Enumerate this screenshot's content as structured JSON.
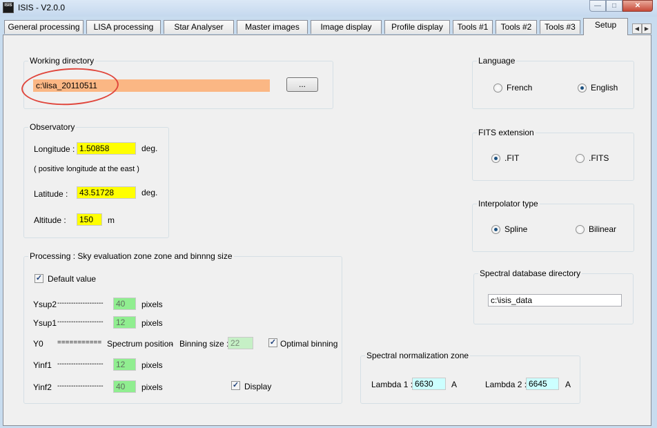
{
  "window": {
    "title": "ISIS - V2.0.0",
    "icon_text": "ISIS"
  },
  "tabs": [
    "General processing",
    "LISA processing",
    "Star Analyser",
    "Master images",
    "Image display",
    "Profile display",
    "Tools #1",
    "Tools #2",
    "Tools #3",
    "Setup"
  ],
  "active_tab": "Setup",
  "working_directory": {
    "title": "Working directory",
    "value": "c:\\lisa_20110511",
    "browse_label": "..."
  },
  "observatory": {
    "title": "Observatory",
    "longitude_label": "Longitude :",
    "longitude_value": "1.50858",
    "longitude_unit": "deg.",
    "longitude_note": "( positive longitude at the east )",
    "latitude_label": "Latitude :",
    "latitude_value": "43.51728",
    "latitude_unit": "deg.",
    "altitude_label": "Altitude :",
    "altitude_value": "150",
    "altitude_unit": "m"
  },
  "processing": {
    "title": "Processing : Sky evaluation zone zone and binnng size",
    "default_value_label": "Default value",
    "default_value_checked": true,
    "ysup2_label": "Ysup2",
    "ysup2_dashes": "--------------------",
    "ysup2_value": "40",
    "ysup1_label": "Ysup1",
    "ysup1_dashes": "--------------------",
    "ysup1_value": "12",
    "y0_label": "Y0",
    "y0_equals": "===========",
    "spectrum_position_label": "Spectrum position",
    "y0_sep": "-",
    "binning_size_label": "Binning size :",
    "binning_size_value": "22",
    "optimal_binning_label": "Optimal binning",
    "optimal_binning_checked": true,
    "yinf1_label": "Yinf1",
    "yinf1_dashes": "--------------------",
    "yinf1_value": "12",
    "yinf2_label": "Yinf2",
    "yinf2_dashes": "--------------------",
    "yinf2_value": "40",
    "pixels_unit": "pixels",
    "display_label": "Display",
    "display_checked": true
  },
  "language": {
    "title": "Language",
    "options": [
      "French",
      "English"
    ],
    "selected": "English"
  },
  "fits_extension": {
    "title": "FITS extension",
    "options": [
      ".FIT",
      ".FITS"
    ],
    "selected": ".FIT"
  },
  "interpolator": {
    "title": "Interpolator type",
    "options": [
      "Spline",
      "Bilinear"
    ],
    "selected": "Spline"
  },
  "spectral_db": {
    "title": "Spectral database directory",
    "value": "c:\\isis_data"
  },
  "normalization": {
    "title": "Spectral normalization zone",
    "lambda1_label": "Lambda 1 :",
    "lambda1_value": "6630",
    "lambda1_unit": "A",
    "lambda2_label": "Lambda 2 :",
    "lambda2_value": "6645",
    "lambda2_unit": "A"
  },
  "colors": {
    "accent_orange": "#fbb784",
    "field_yellow": "#ffff00",
    "field_green": "#90ee90",
    "field_cyan": "#ccffff",
    "annotation_red": "#e0463c"
  }
}
